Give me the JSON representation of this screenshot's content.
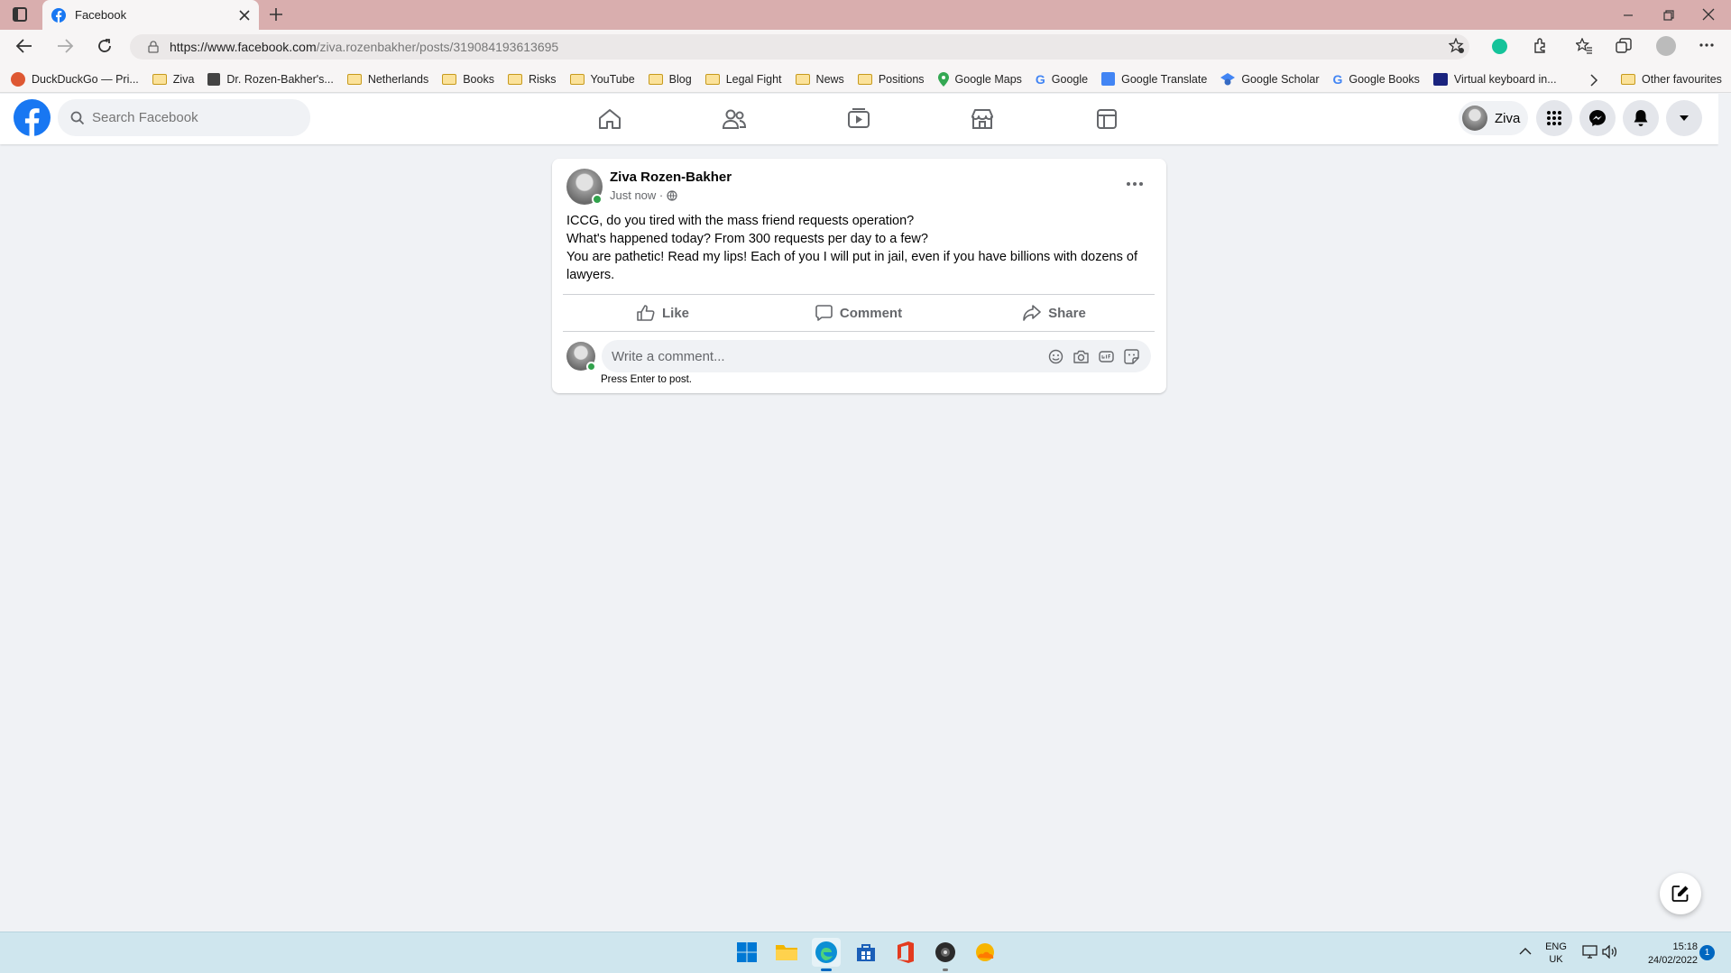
{
  "browser": {
    "tab_title": "Facebook",
    "url_host": "https://www.facebook.com",
    "url_path": "/ziva.rozenbakher/posts/319084193613695",
    "bookmarks": [
      {
        "label": "DuckDuckGo — Pri...",
        "icon": "duckduckgo-icon"
      },
      {
        "label": "Ziva",
        "icon": "folder-icon"
      },
      {
        "label": "Dr. Rozen-Bakher's...",
        "icon": "cube-icon"
      },
      {
        "label": "Netherlands",
        "icon": "folder-icon"
      },
      {
        "label": "Books",
        "icon": "folder-icon"
      },
      {
        "label": "Risks",
        "icon": "folder-icon"
      },
      {
        "label": "YouTube",
        "icon": "folder-icon"
      },
      {
        "label": "Blog",
        "icon": "folder-icon"
      },
      {
        "label": "Legal Fight",
        "icon": "folder-icon"
      },
      {
        "label": "News",
        "icon": "folder-icon"
      },
      {
        "label": "Positions",
        "icon": "folder-icon"
      },
      {
        "label": "Google Maps",
        "icon": "maps-icon"
      },
      {
        "label": "Google",
        "icon": "google-icon"
      },
      {
        "label": "Google Translate",
        "icon": "translate-icon"
      },
      {
        "label": "Google Scholar",
        "icon": "scholar-icon"
      },
      {
        "label": "Google Books",
        "icon": "google-icon"
      },
      {
        "label": "Virtual keyboard in...",
        "icon": "keyboard-icon"
      }
    ],
    "other_favourites": "Other favourites"
  },
  "fb": {
    "search_placeholder": "Search Facebook",
    "profile_name": "Ziva"
  },
  "post": {
    "author": "Ziva Rozen-Bakher",
    "time": "Just now ·",
    "lines": [
      "ICCG, do you tired with the mass friend requests operation?",
      "What's happened today? From 300 requests per day to a few?",
      "You are pathetic! Read my lips! Each of you I will put in jail, even if you have billions with dozens of lawyers."
    ],
    "like_label": "Like",
    "comment_label": "Comment",
    "share_label": "Share",
    "comment_placeholder": "Write a comment...",
    "press_enter": "Press Enter to post."
  },
  "taskbar": {
    "lang_top": "ENG",
    "lang_bottom": "UK",
    "time": "15:18",
    "date": "24/02/2022",
    "notif_count": "1"
  },
  "colors": {
    "fb_blue": "#1877f2",
    "tab_strip": "#d9aeae"
  }
}
